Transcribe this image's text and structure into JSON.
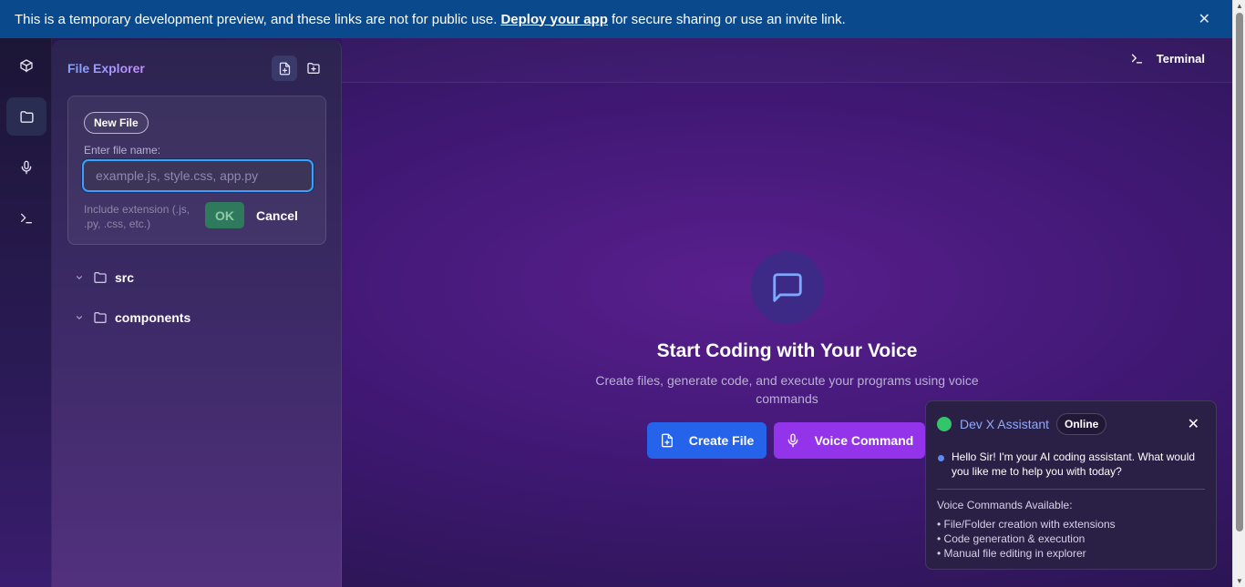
{
  "banner": {
    "text_before": "This is a temporary development preview, and these links are not for public use.",
    "link": "Deploy your app",
    "text_after": "for secure sharing or use an invite link.",
    "close": "✕"
  },
  "file_explorer": {
    "title": "File Explorer",
    "new_file_form": {
      "chip": "New File",
      "label": "Enter file name:",
      "placeholder": "example.js, style.css, app.py",
      "value": "",
      "hint": "Include extension (.js, .py, .css, etc.)",
      "ok": "OK",
      "cancel": "Cancel"
    },
    "tree": [
      {
        "name": "src"
      },
      {
        "name": "components"
      }
    ]
  },
  "topbar": {
    "terminal": "Terminal"
  },
  "hero": {
    "title": "Start Coding with Your Voice",
    "subtitle": "Create files, generate code, and execute your programs using voice commands",
    "create_file": "Create File",
    "voice_command": "Voice Command"
  },
  "assistant": {
    "name": "Dev X Assistant",
    "status": "Online",
    "close": "✕",
    "message": "Hello Sir! I'm your AI coding assistant. What would you like me to help you with today?",
    "commands_title": "Voice Commands Available:",
    "commands": [
      "• File/Folder creation with extensions",
      "• Code generation & execution",
      "• Manual file editing in explorer"
    ]
  },
  "colors": {
    "banner": "#0a4a8c",
    "accent_blue": "#2563eb",
    "accent_purple": "#9333ea",
    "online_green": "#34c56a"
  }
}
